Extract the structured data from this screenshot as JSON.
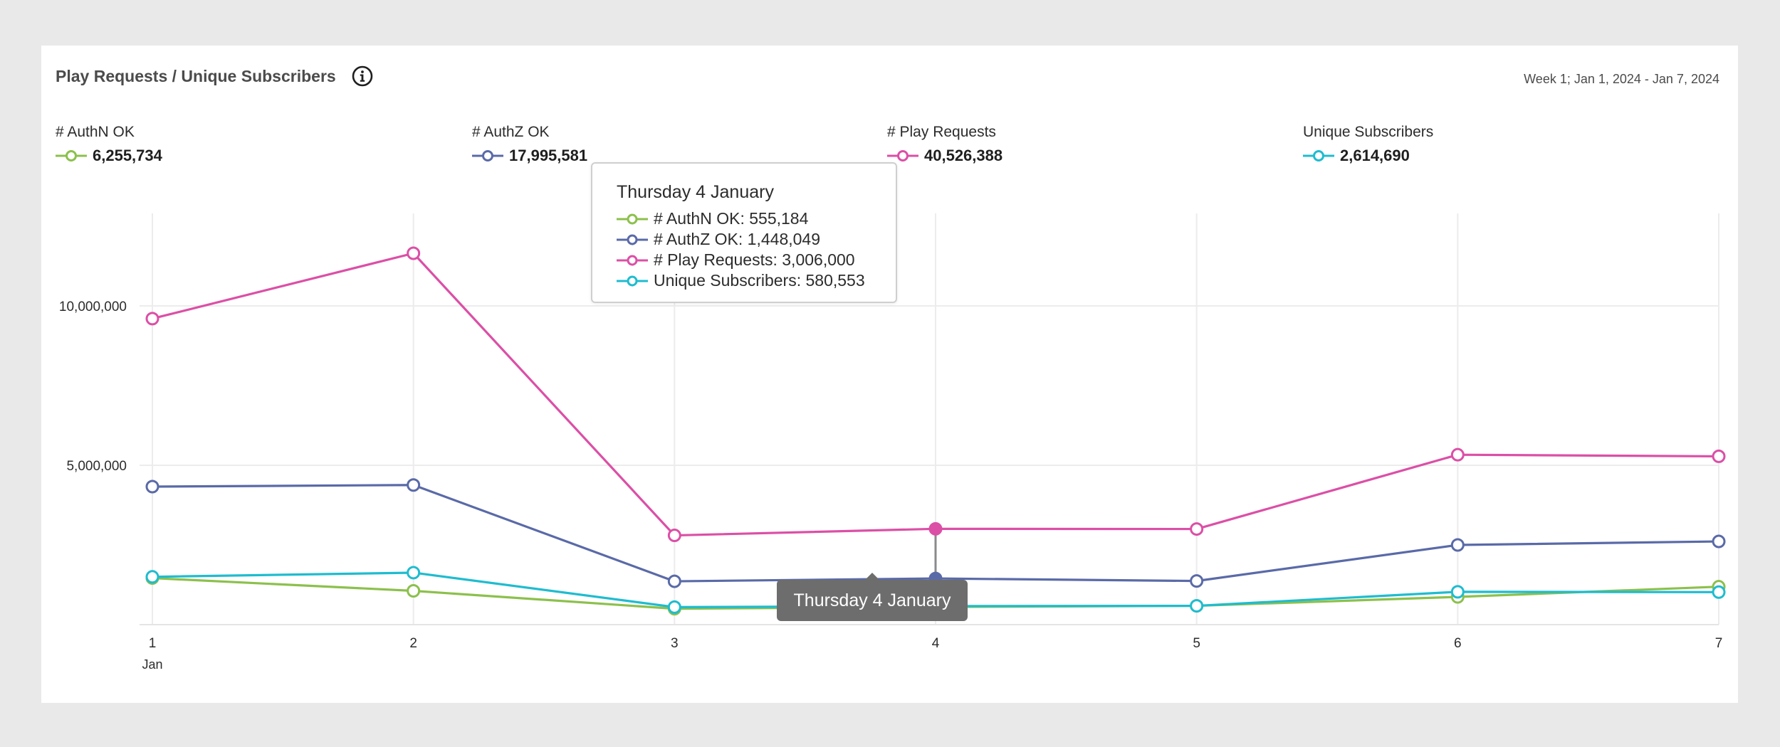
{
  "header": {
    "title": "Play Requests / Unique Subscribers",
    "date_range": "Week 1; Jan 1, 2024 - Jan 7, 2024"
  },
  "legend": [
    {
      "name": "# AuthN OK",
      "total": "6,255,734",
      "color": "#8cc04c"
    },
    {
      "name": "# AuthZ OK",
      "total": "17,995,581",
      "color": "#5a6aa8"
    },
    {
      "name": "# Play Requests",
      "total": "40,526,388",
      "color": "#dc4fa6"
    },
    {
      "name": "Unique Subscribers",
      "total": "2,614,690",
      "color": "#1fbccf"
    }
  ],
  "tooltip": {
    "title": "Thursday 4 January",
    "rows": [
      "# AuthN OK: 555,184",
      "# AuthZ OK: 1,448,049",
      "# Play Requests: 3,006,000",
      "Unique Subscribers: 580,553"
    ]
  },
  "x_badge": "Thursday 4 January",
  "chart_data": {
    "type": "line",
    "x": [
      1,
      2,
      3,
      4,
      5,
      6,
      7
    ],
    "x_tick_labels": [
      "1",
      "2",
      "3",
      "4",
      "5",
      "6",
      "7"
    ],
    "x_sub_label": "Jan",
    "y_ticks": [
      5000000,
      10000000
    ],
    "y_tick_labels": [
      "5,000,000",
      "10,000,000"
    ],
    "ylim": [
      0,
      12900000
    ],
    "grid": true,
    "highlight_index": 3,
    "series": [
      {
        "name": "# Play Requests",
        "color": "#dc4fa6",
        "values": [
          9600000,
          11650000,
          2800000,
          3006000,
          3000000,
          5330000,
          5280000
        ]
      },
      {
        "name": "# AuthZ OK",
        "color": "#5a6aa8",
        "values": [
          4330000,
          4380000,
          1360000,
          1448049,
          1370000,
          2500000,
          2610000
        ]
      },
      {
        "name": "# AuthN OK",
        "color": "#8cc04c",
        "values": [
          1460000,
          1060000,
          500000,
          555184,
          590000,
          870000,
          1190000
        ]
      },
      {
        "name": "Unique Subscribers",
        "color": "#1fbccf",
        "values": [
          1500000,
          1630000,
          550000,
          580553,
          590000,
          1030000,
          1020000
        ]
      }
    ]
  }
}
